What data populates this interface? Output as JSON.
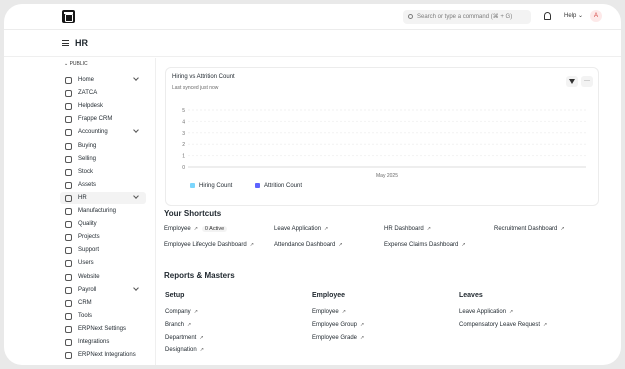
{
  "topbar": {
    "search_placeholder": "Search or type a command (⌘ + G)",
    "help_label": "Help",
    "avatar_initial": "A"
  },
  "page": {
    "title": "HR"
  },
  "sidebar": {
    "section_label": "PUBLIC",
    "items": [
      {
        "label": "Home",
        "icon": "home-icon",
        "chevron": true
      },
      {
        "label": "ZATCA",
        "icon": "link-icon",
        "chevron": false
      },
      {
        "label": "Helpdesk",
        "icon": "headset-icon",
        "chevron": false
      },
      {
        "label": "Frappe CRM",
        "icon": "funnel-icon",
        "chevron": false
      },
      {
        "label": "Accounting",
        "icon": "wallet-icon",
        "chevron": true
      },
      {
        "label": "Buying",
        "icon": "bag-icon",
        "chevron": false
      },
      {
        "label": "Selling",
        "icon": "tag-icon",
        "chevron": false
      },
      {
        "label": "Stock",
        "icon": "box-icon",
        "chevron": false
      },
      {
        "label": "Assets",
        "icon": "asset-icon",
        "chevron": false
      },
      {
        "label": "HR",
        "icon": "users-icon",
        "chevron": true,
        "active": true
      },
      {
        "label": "Manufacturing",
        "icon": "factory-icon",
        "chevron": false
      },
      {
        "label": "Quality",
        "icon": "quality-icon",
        "chevron": false
      },
      {
        "label": "Projects",
        "icon": "folder-icon",
        "chevron": false
      },
      {
        "label": "Support",
        "icon": "support-icon",
        "chevron": false
      },
      {
        "label": "Users",
        "icon": "user-icon",
        "chevron": false
      },
      {
        "label": "Website",
        "icon": "web-icon",
        "chevron": false
      },
      {
        "label": "Payroll",
        "icon": "money-icon",
        "chevron": true
      },
      {
        "label": "CRM",
        "icon": "crm-icon",
        "chevron": false
      },
      {
        "label": "Tools",
        "icon": "tools-icon",
        "chevron": false
      },
      {
        "label": "ERPNext Settings",
        "icon": "settings-icon",
        "chevron": false
      },
      {
        "label": "Integrations",
        "icon": "plug-icon",
        "chevron": false
      },
      {
        "label": "ERPNext Integrations",
        "icon": "plug-icon",
        "chevron": false
      }
    ]
  },
  "chart_card": {
    "title": "Hiring vs Attrition Count",
    "subtitle": "Last synced just now",
    "more_label": "···"
  },
  "chart_data": {
    "type": "bar",
    "title": "Hiring vs Attrition Count",
    "categories": [
      "May 2025"
    ],
    "series": [
      {
        "name": "Hiring Count",
        "values": [
          0
        ],
        "color": "#7cd6fd"
      },
      {
        "name": "Attrition Count",
        "values": [
          0
        ],
        "color": "#5e64ff"
      }
    ],
    "yticks": [
      "0",
      "1",
      "2",
      "3",
      "4",
      "5"
    ],
    "ylim": [
      0,
      5
    ],
    "grid": true,
    "legend": "bottom-left"
  },
  "shortcuts": {
    "heading": "Your Shortcuts",
    "items": [
      {
        "label": "Employee",
        "badge": "0 Active"
      },
      {
        "label": "Leave Application"
      },
      {
        "label": "HR Dashboard"
      },
      {
        "label": "Recruitment Dashboard"
      },
      {
        "label": "Employee Lifecycle Dashboard"
      },
      {
        "label": "Attendance Dashboard"
      },
      {
        "label": "Expense Claims Dashboard"
      }
    ]
  },
  "reports": {
    "heading": "Reports & Masters",
    "columns": [
      {
        "title": "Setup",
        "links": [
          "Company",
          "Branch",
          "Department",
          "Designation"
        ]
      },
      {
        "title": "Employee",
        "links": [
          "Employee",
          "Employee Group",
          "Employee Grade"
        ]
      },
      {
        "title": "Leaves",
        "links": [
          "Leave Application",
          "Compensatory Leave Request"
        ]
      }
    ]
  }
}
